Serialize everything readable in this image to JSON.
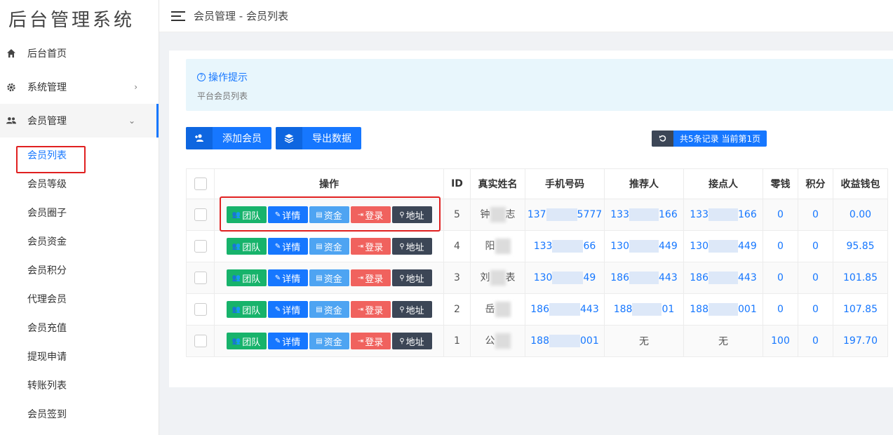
{
  "app": {
    "logo_text": "后台管理系统"
  },
  "sidebar": {
    "items": [
      {
        "label": "后台首页",
        "icon": "home-icon"
      },
      {
        "label": "系统管理",
        "icon": "gear-icon",
        "arrow": "›"
      },
      {
        "label": "会员管理",
        "icon": "users-icon",
        "arrow": "⌄"
      }
    ],
    "submenu": [
      "会员列表",
      "会员等级",
      "会员圈子",
      "会员资金",
      "会员积分",
      "代理会员",
      "会员充值",
      "提现申请",
      "转账列表",
      "会员签到"
    ]
  },
  "topbar": {
    "breadcrumb": "会员管理 - 会员列表"
  },
  "tip": {
    "title": "操作提示",
    "desc": "平台会员列表"
  },
  "toolbar": {
    "add_label": "添加会员",
    "export_label": "导出数据",
    "records_text": "共5条记录 当前第1页"
  },
  "table": {
    "headers": [
      "操作",
      "ID",
      "真实姓名",
      "手机号码",
      "推荐人",
      "接点人",
      "零钱",
      "积分",
      "收益钱包"
    ],
    "ops": {
      "team": "团队",
      "detail": "详情",
      "fund": "资金",
      "login": "登录",
      "addr": "地址"
    },
    "rows": [
      {
        "id": "5",
        "name_a": "钟",
        "name_b": "志",
        "phone_a": "137",
        "phone_b": "5777",
        "ref_a": "133",
        "ref_b": "166",
        "node_a": "133",
        "node_b": "166",
        "change": "0",
        "points": "0",
        "wallet": "0.00"
      },
      {
        "id": "4",
        "name_a": "阳",
        "name_b": "",
        "phone_a": "133",
        "phone_b": "66",
        "ref_a": "130",
        "ref_b": "449",
        "node_a": "130",
        "node_b": "449",
        "change": "0",
        "points": "0",
        "wallet": "95.85"
      },
      {
        "id": "3",
        "name_a": "刘",
        "name_b": "表",
        "phone_a": "130",
        "phone_b": "49",
        "ref_a": "186",
        "ref_b": "443",
        "node_a": "186",
        "node_b": "443",
        "change": "0",
        "points": "0",
        "wallet": "101.85"
      },
      {
        "id": "2",
        "name_a": "岳",
        "name_b": "",
        "phone_a": "186",
        "phone_b": "443",
        "ref_a": "188",
        "ref_b": "01",
        "node_a": "188",
        "node_b": "001",
        "change": "0",
        "points": "0",
        "wallet": "107.85"
      },
      {
        "id": "1",
        "name_a": "公",
        "name_b": "",
        "phone_a": "188",
        "phone_b": "001",
        "ref_a": "",
        "ref_b": "",
        "ref_text": "无",
        "node_text": "无",
        "change": "100",
        "points": "0",
        "wallet": "197.70"
      }
    ]
  }
}
